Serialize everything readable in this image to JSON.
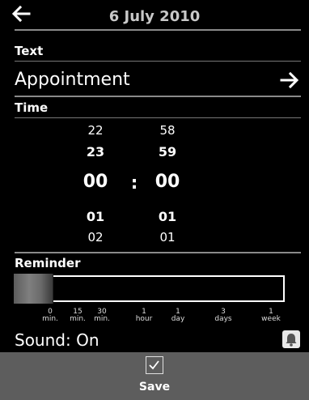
{
  "header": {
    "title": "6 July 2010",
    "back_icon": "back-arrow-icon"
  },
  "text_section": {
    "label": "Text",
    "value": "Appointment",
    "next_icon": "forward-arrow-icon"
  },
  "time_section": {
    "label": "Time",
    "hours": {
      "row1": "22",
      "row2": "23",
      "selected": "00",
      "row4": "01",
      "row5": "02"
    },
    "minutes": {
      "row1": "58",
      "row2": "59",
      "selected": "00",
      "row4": "01",
      "row5": "01"
    },
    "separator": ":"
  },
  "reminder_section": {
    "label": "Reminder",
    "selected_index": 0,
    "ticks": [
      {
        "top": "0",
        "bottom": "min."
      },
      {
        "top": "15",
        "bottom": "min."
      },
      {
        "top": "30",
        "bottom": "min."
      },
      {
        "top": "1",
        "bottom": "hour"
      },
      {
        "top": "1",
        "bottom": "day"
      },
      {
        "top": "3",
        "bottom": "days"
      },
      {
        "top": "1",
        "bottom": "week"
      }
    ]
  },
  "sound": {
    "label": "Sound: On",
    "icon": "bell-icon"
  },
  "footer": {
    "save_label": "Save",
    "save_icon": "checkbox-icon"
  },
  "colors": {
    "background": "#000000",
    "bottom_bar": "#5d5d5d",
    "header_title": "#c8c8c8"
  }
}
